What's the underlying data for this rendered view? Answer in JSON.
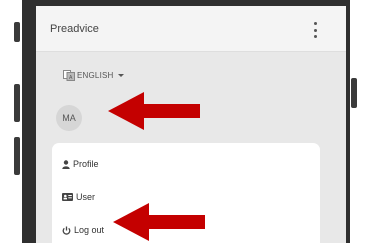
{
  "appbar": {
    "title": "Preadvice"
  },
  "language": {
    "selected": "ENGLISH"
  },
  "avatar": {
    "initials": "MA"
  },
  "menu": {
    "items": [
      {
        "label": "Profile",
        "icon": "user-icon"
      },
      {
        "label": "User",
        "icon": "id-card-icon"
      },
      {
        "label": "Log out",
        "icon": "power-icon"
      }
    ]
  },
  "colors": {
    "arrow": "#c40000",
    "screen_bg": "#e8e8e8",
    "device": "#2f2f2f"
  }
}
